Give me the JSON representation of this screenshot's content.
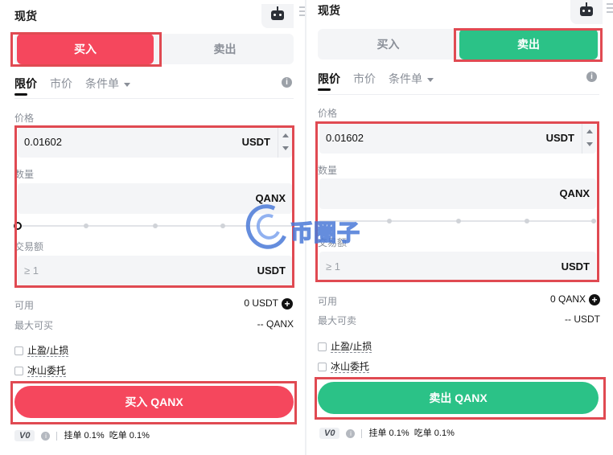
{
  "left": {
    "title": "现货",
    "tabs": {
      "buy": "买入",
      "sell": "卖出"
    },
    "order_tabs": [
      "限价",
      "市价",
      "条件单"
    ],
    "price": {
      "label": "价格",
      "value": "0.01602",
      "unit": "USDT"
    },
    "amount": {
      "label": "数量",
      "value": "",
      "unit": "QANX"
    },
    "total": {
      "label": "交易额",
      "placeholder": "≥ 1",
      "unit": "USDT"
    },
    "available": {
      "label": "可用",
      "value": "0 USDT"
    },
    "max": {
      "label": "最大可买",
      "value": "-- QANX"
    },
    "checkboxes": [
      "止盈/止损",
      "冰山委托"
    ],
    "action": "买入 QANX",
    "fee": {
      "tier": "V0",
      "maker": "挂单 0.1%",
      "taker": "吃单 0.1%"
    }
  },
  "right": {
    "title": "现货",
    "tabs": {
      "buy": "买入",
      "sell": "卖出"
    },
    "order_tabs": [
      "限价",
      "市价",
      "条件单"
    ],
    "price": {
      "label": "价格",
      "value": "0.01602",
      "unit": "USDT"
    },
    "amount": {
      "label": "数量",
      "value": "",
      "unit": "QANX"
    },
    "total": {
      "label": "交易额",
      "placeholder": "≥ 1",
      "unit": "USDT"
    },
    "available": {
      "label": "可用",
      "value": "0 QANX"
    },
    "max": {
      "label": "最大可卖",
      "value": "-- USDT"
    },
    "checkboxes": [
      "止盈/止损",
      "冰山委托"
    ],
    "action": "卖出 QANX",
    "fee": {
      "tier": "V0",
      "maker": "挂单 0.1%",
      "taker": "吃单 0.1%"
    }
  },
  "watermark": "币圈子",
  "colors": {
    "buy": "#f5475d",
    "sell": "#2bc287",
    "highlight": "#e04a52"
  }
}
